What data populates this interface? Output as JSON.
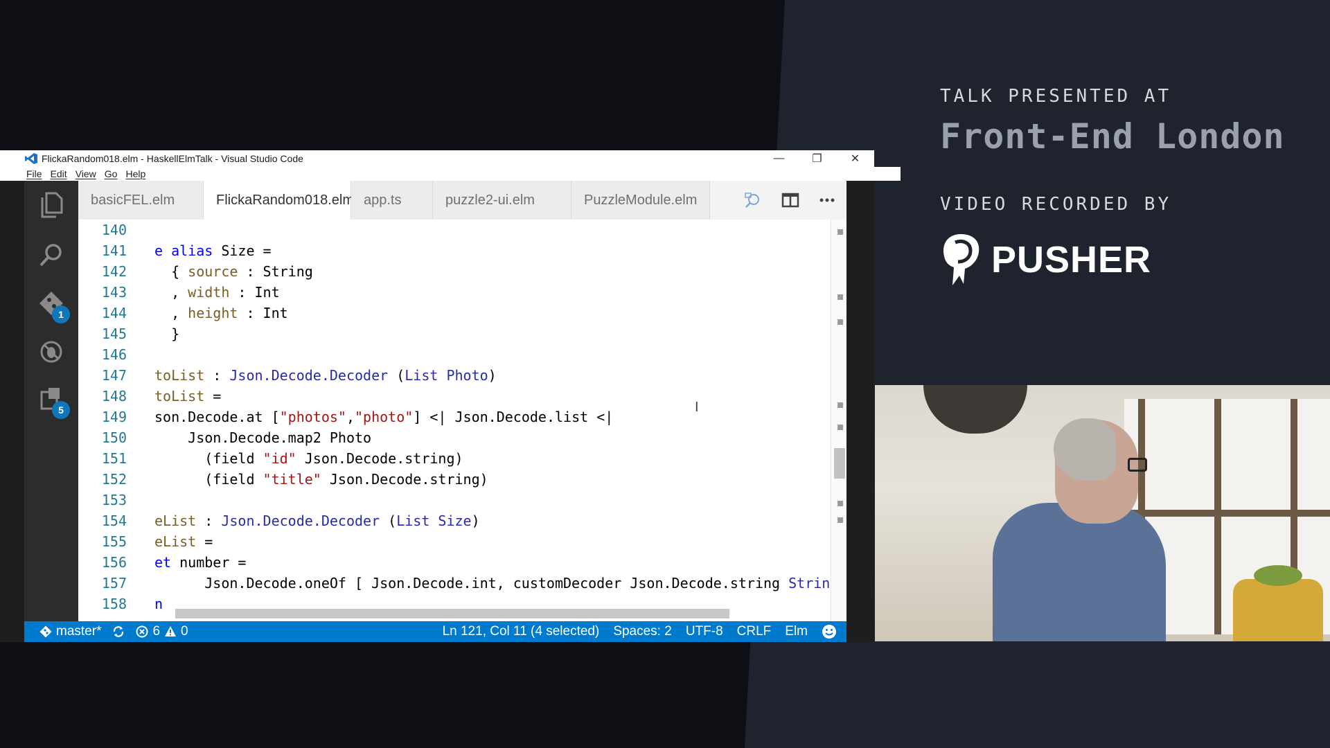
{
  "branding": {
    "kicker1": "TALK PRESENTED AT",
    "event": "Front-End London",
    "kicker2": "VIDEO RECORDED BY",
    "sponsor": "PUSHER"
  },
  "window": {
    "title": "FlickaRandom018.elm - HaskellElmTalk - Visual Studio Code",
    "icon": "vscode-logo-icon"
  },
  "menu": [
    "File",
    "Edit",
    "View",
    "Go",
    "Help"
  ],
  "activity": {
    "git_badge": "1",
    "extensions_badge": "5"
  },
  "tabs": [
    {
      "label": "basicFEL.elm"
    },
    {
      "label": "FlickaRandom018.elm"
    },
    {
      "label": "app.ts"
    },
    {
      "label": "puzzle2-ui.elm"
    },
    {
      "label": "PuzzleModule.elm"
    }
  ],
  "editor": {
    "line_numbers": [
      "140",
      "141",
      "142",
      "143",
      "144",
      "145",
      "146",
      "147",
      "148",
      "149",
      "150",
      "151",
      "152",
      "153",
      "154",
      "155",
      "156",
      "157",
      "158"
    ]
  },
  "status": {
    "branch": "master*",
    "errors": "6",
    "warnings": "0",
    "position": "Ln 121, Col 11 (4 selected)",
    "spaces": "Spaces: 2",
    "encoding": "UTF-8",
    "eol": "CRLF",
    "language": "Elm",
    "accent_color": "#007acc"
  }
}
